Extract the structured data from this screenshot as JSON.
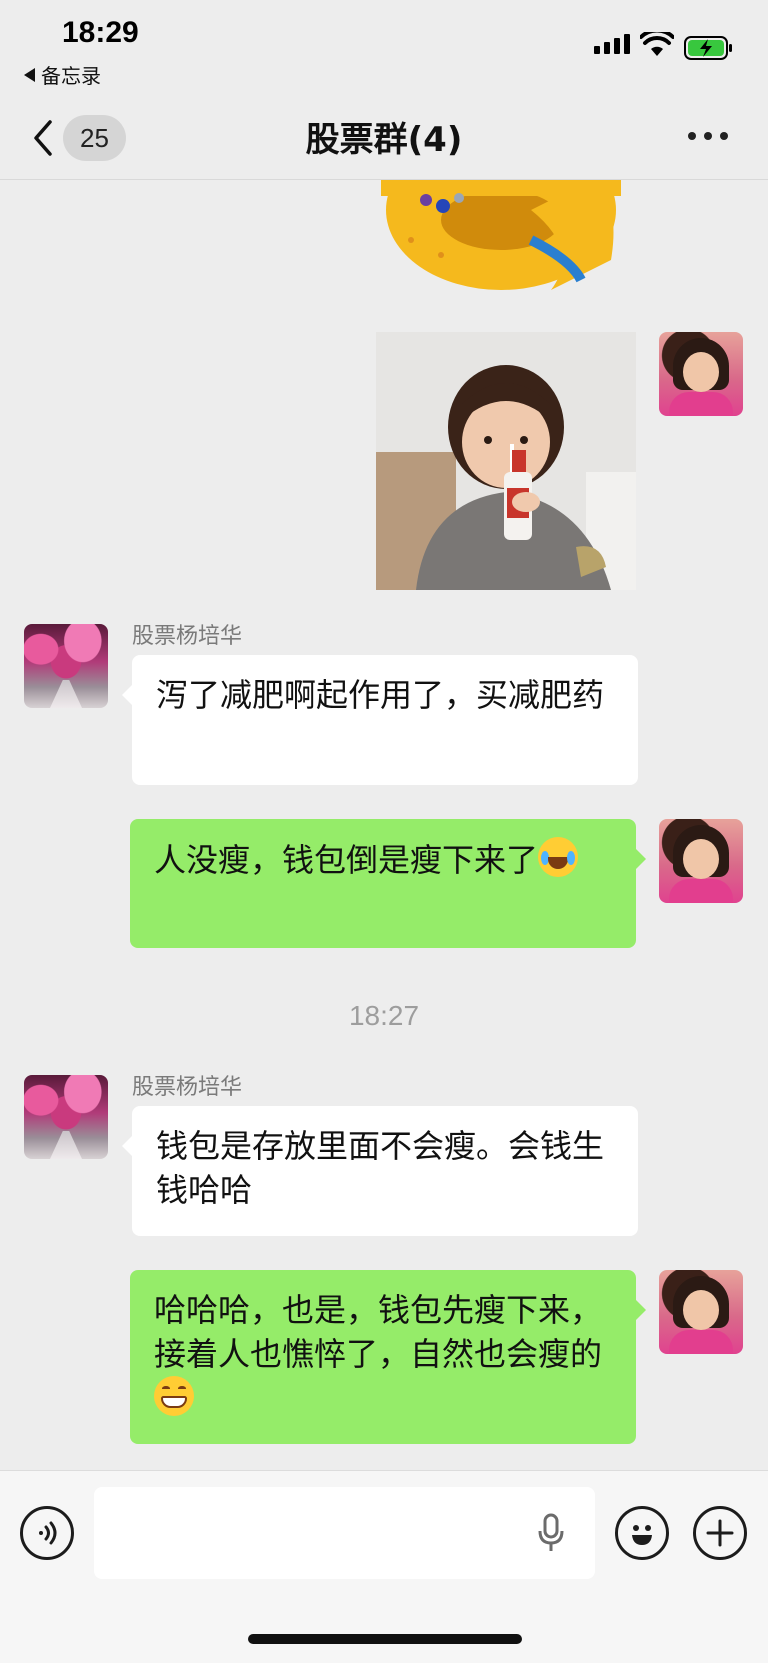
{
  "status_bar": {
    "time": "18:29",
    "back_app": "备忘录",
    "icons": [
      "signal-icon",
      "wifi-icon",
      "battery-charging-icon"
    ]
  },
  "nav": {
    "unread_count": "25",
    "title": "股票群(4)",
    "icons": [
      "back-chevron-icon",
      "more-icon"
    ]
  },
  "messages": [
    {
      "type": "sticker",
      "side": "self",
      "description_icon": "ring-hand-sticker"
    },
    {
      "type": "sticker",
      "side": "self",
      "description_icon": "child-drinking-sticker"
    },
    {
      "type": "text",
      "side": "other",
      "sender": "股票杨培华",
      "text": "泻了减肥啊起作用了，买减肥药"
    },
    {
      "type": "text",
      "side": "self",
      "text": "人没瘦，钱包倒是瘦下来了",
      "emoji": "laugh-cry-emoji"
    },
    {
      "type": "time",
      "text": "18:27"
    },
    {
      "type": "text",
      "side": "other",
      "sender": "股票杨培华",
      "text": "钱包是存放里面不会瘦。会钱生钱哈哈"
    },
    {
      "type": "text",
      "side": "self",
      "text": "哈哈哈，也是，钱包先瘦下来，接着人也憔悴了，自然也会瘦的",
      "emoji": "grin-emoji"
    }
  ],
  "input_bar": {
    "value": "",
    "placeholder": "",
    "icons": [
      "voice-icon",
      "mic-icon",
      "emoji-icon",
      "plus-icon"
    ]
  },
  "colors": {
    "background": "#ededed",
    "outgoing_bubble": "#95ec69",
    "incoming_bubble": "#ffffff",
    "timestamp": "#9d9d9d",
    "sender_name": "#7a7a7a"
  }
}
